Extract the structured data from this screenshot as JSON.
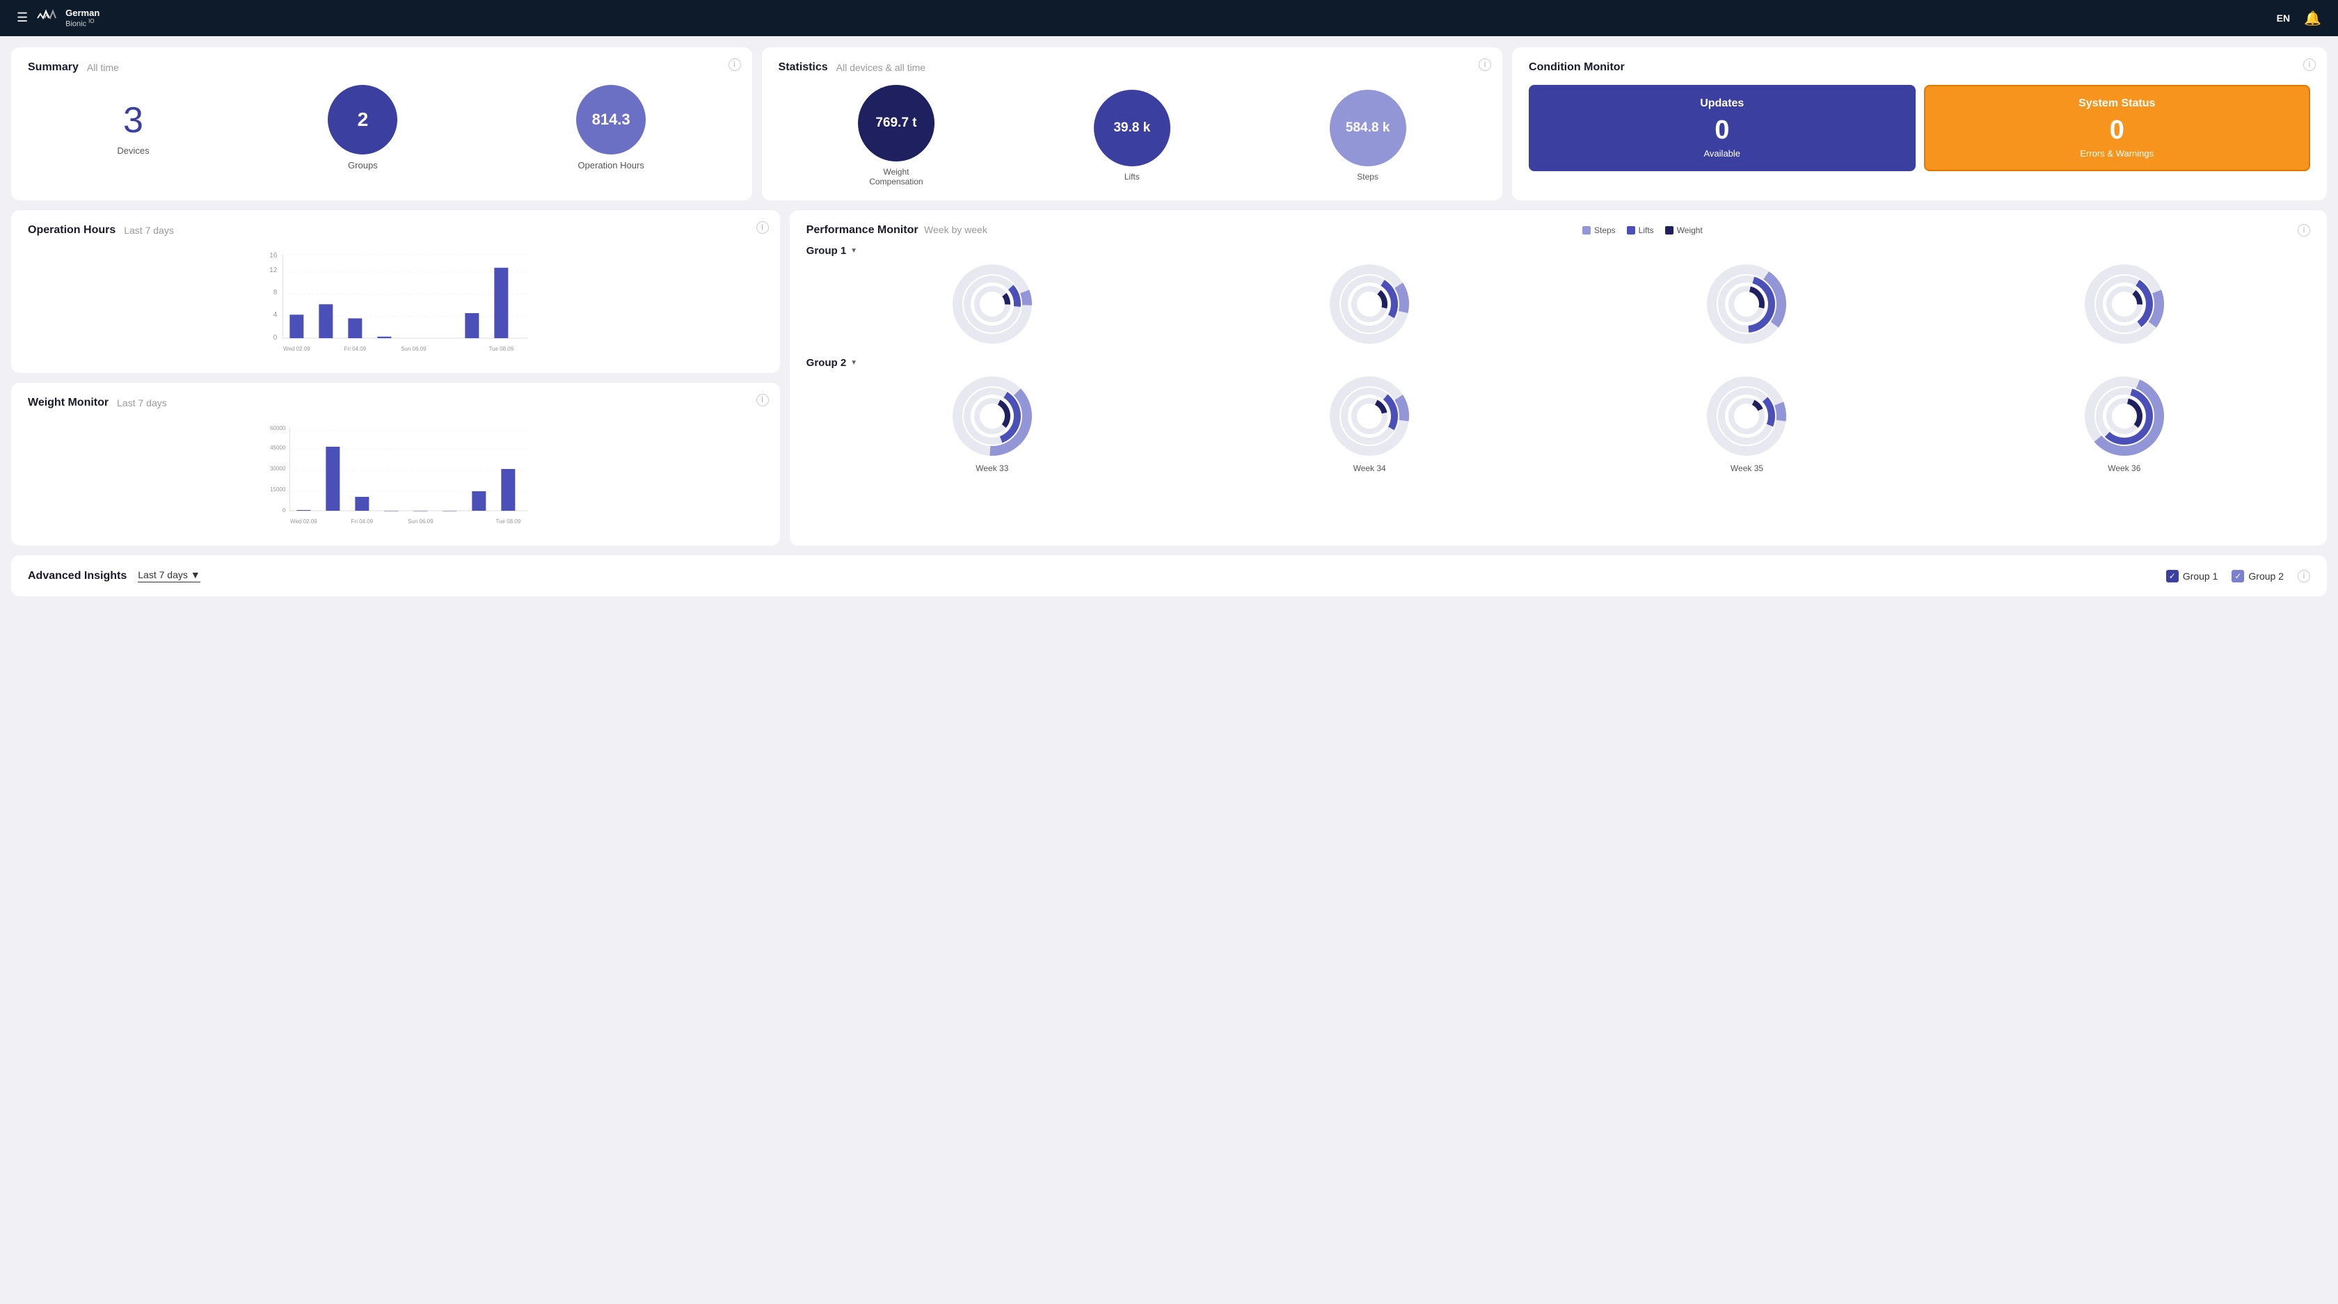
{
  "header": {
    "menu_icon": "☰",
    "logo_name": "German",
    "logo_suffix": "Bionic",
    "logo_sup": "IO",
    "language": "EN",
    "bell": "🔔"
  },
  "summary": {
    "title": "Summary",
    "subtitle": "All time",
    "devices_count": "3",
    "devices_label": "Devices",
    "groups_count": "2",
    "groups_label": "Groups",
    "hours_count": "814.3",
    "hours_label": "Operation Hours"
  },
  "statistics": {
    "title": "Statistics",
    "subtitle": "All devices & all time",
    "weight_val": "769.7 t",
    "weight_label": "Weight\nCompensation",
    "lifts_val": "39.8 k",
    "lifts_label": "Lifts",
    "steps_val": "584.8 k",
    "steps_label": "Steps"
  },
  "condition": {
    "title": "Condition Monitor",
    "updates_label": "Updates",
    "updates_count": "0",
    "updates_sub": "Available",
    "status_label": "System Status",
    "status_count": "0",
    "status_sub": "Errors & Warnings"
  },
  "operation_hours": {
    "title": "Operation Hours",
    "subtitle": "Last 7 days",
    "y_labels": [
      "0",
      "4",
      "8",
      "12",
      "16"
    ],
    "x_labels": [
      "Wed 02.09",
      "Fri 04.09",
      "Sun 06.09",
      "Tue 08.09"
    ],
    "bars": [
      {
        "day": "Wed 02.09",
        "val": 4.5
      },
      {
        "day": "",
        "val": 6.5
      },
      {
        "day": "Fri 04.09",
        "val": 3.8
      },
      {
        "day": "",
        "val": 0.3
      },
      {
        "day": "Sun 06.09",
        "val": 0
      },
      {
        "day": "",
        "val": 0
      },
      {
        "day": "",
        "val": 4.8
      },
      {
        "day": "Tue 08.09",
        "val": 13.5
      }
    ]
  },
  "weight_monitor": {
    "title": "Weight Monitor",
    "subtitle": "Last 7 days",
    "y_labels": [
      "0",
      "15000",
      "30000",
      "45000",
      "60000"
    ],
    "x_labels": [
      "Wed 02.09",
      "Fri 04.09",
      "Sun 06.09",
      "Tue 08.09"
    ],
    "bars": [
      {
        "day": "Wed 02.09",
        "val": 500
      },
      {
        "day": "",
        "val": 46000
      },
      {
        "day": "Fri 04.09",
        "val": 10000
      },
      {
        "day": "",
        "val": 0
      },
      {
        "day": "Sun 06.09",
        "val": 0
      },
      {
        "day": "",
        "val": 0
      },
      {
        "day": "",
        "val": 14000
      },
      {
        "day": "Tue 08.09",
        "val": 30000
      }
    ]
  },
  "performance": {
    "title": "Performance Monitor",
    "subtitle": "Week by week",
    "legend_steps": "Steps",
    "legend_lifts": "Lifts",
    "legend_weight": "Weight",
    "group1_label": "Group 1",
    "group2_label": "Group 2",
    "week_labels": [
      "Week 33",
      "Week 34",
      "Week 35",
      "Week 36"
    ]
  },
  "advanced_insights": {
    "title": "Advanced Insights",
    "time_label": "Last 7 days",
    "group1_label": "Group 1",
    "group2_label": "Group 2"
  }
}
